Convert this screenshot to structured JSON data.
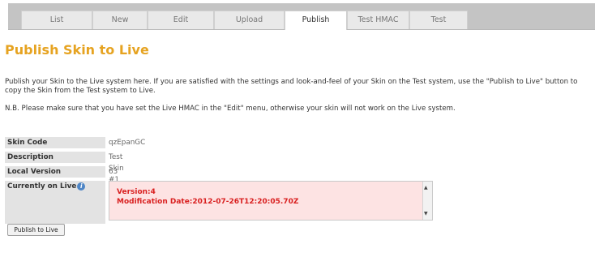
{
  "tabs": [
    {
      "label": "List",
      "active": false
    },
    {
      "label": "New",
      "active": false
    },
    {
      "label": "Edit",
      "active": false
    },
    {
      "label": "Upload",
      "active": false
    },
    {
      "label": "Publish",
      "active": true
    },
    {
      "label": "Test HMAC",
      "active": false
    },
    {
      "label": "Test",
      "active": false
    }
  ],
  "page_title": "Publish Skin to Live",
  "intro_text": "Publish your Skin to the Live system here. If you are satisfied with the settings and look-and-feel of your Skin on the Test system, use the \"Publish to Live\" button to copy the Skin from the Test system to Live.",
  "note_text": "N.B. Please make sure that you have set the Live HMAC in the \"Edit\" menu, otherwise your skin will not work on the Live system.",
  "details": {
    "skin_code_label": "Skin Code",
    "skin_code_value": "qzEpanGC",
    "description_label": "Description",
    "description_value": "Test Skin #1",
    "local_version_label": "Local Version",
    "local_version_value": "63",
    "currently_on_live_label": "Currently on Live"
  },
  "live_info": {
    "version_line": "Version:4",
    "modification_line": "Modification Date:2012-07-26T12:20:05.70Z"
  },
  "publish_button_label": "Publish to Live",
  "colors": {
    "title": "#e6a321",
    "live_text": "#d92020",
    "live_background": "#fde3e3",
    "tab_bar": "#c4c4c4",
    "label_background": "#e3e3e3"
  },
  "icons": {
    "info": "info-circle-icon"
  }
}
